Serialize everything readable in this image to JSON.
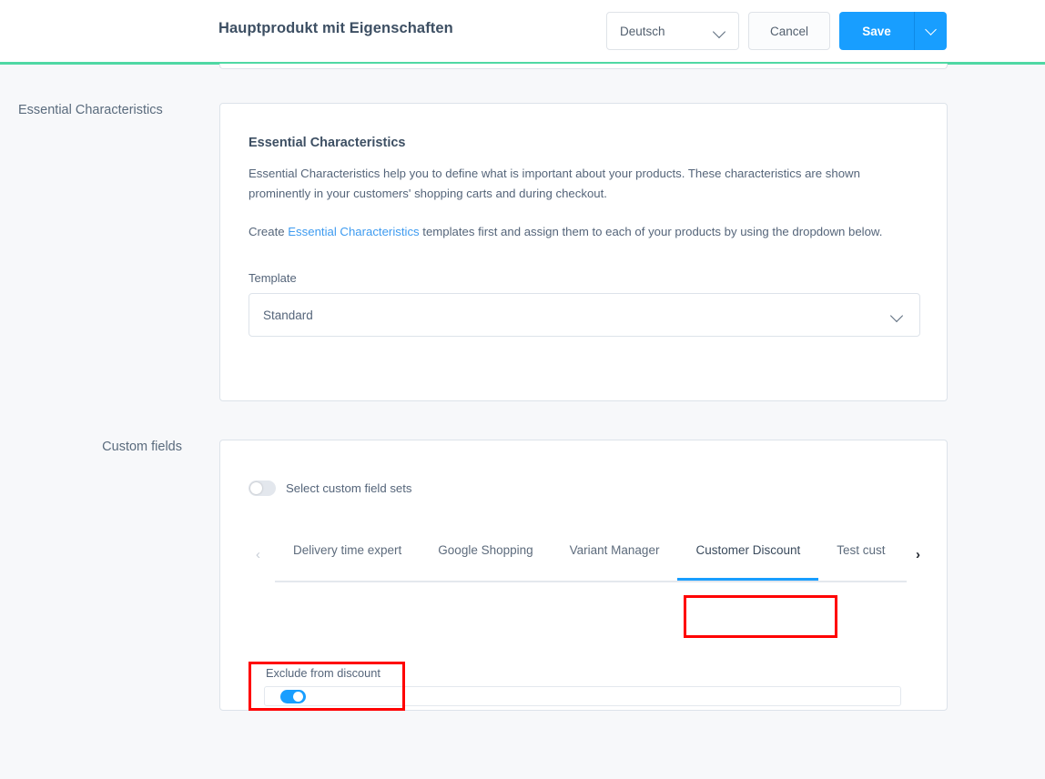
{
  "header": {
    "title": "Hauptprodukt mit Eigenschaften",
    "language_value": "Deutsch",
    "cancel_label": "Cancel",
    "save_label": "Save",
    "accent_color": "#4fd8a4",
    "primary_color": "#189eff"
  },
  "sections": [
    {
      "sidebar_label": "Essential Characteristics",
      "card_heading": "Essential Characteristics",
      "paragraph_1": "Essential Characteristics help you to define what is important about your products. These characteristics are shown prominently in your customers' shopping carts and during checkout.",
      "paragraph_2_before": "Create ",
      "paragraph_2_link": "Essential Characteristics",
      "paragraph_2_after": " templates first and assign them to each of your products by using the dropdown below.",
      "template_label": "Template",
      "template_value": "Standard",
      "link_color": "#3e9bf0"
    },
    {
      "sidebar_label": "Custom fields",
      "switch_label": "Select custom field sets",
      "switch_state": "off",
      "tabs": [
        {
          "label": "Delivery time expert",
          "active": false
        },
        {
          "label": "Google Shopping",
          "active": false
        },
        {
          "label": "Variant Manager",
          "active": false
        },
        {
          "label": "Customer Discount",
          "active": true
        },
        {
          "label": "Test cust",
          "active": false
        }
      ],
      "tab_arrow_left": "‹",
      "tab_arrow_right": "›",
      "custom_field": {
        "label": "Exclude from discount",
        "toggle_state": "on"
      },
      "highlight_color": "#ff0000"
    }
  ]
}
